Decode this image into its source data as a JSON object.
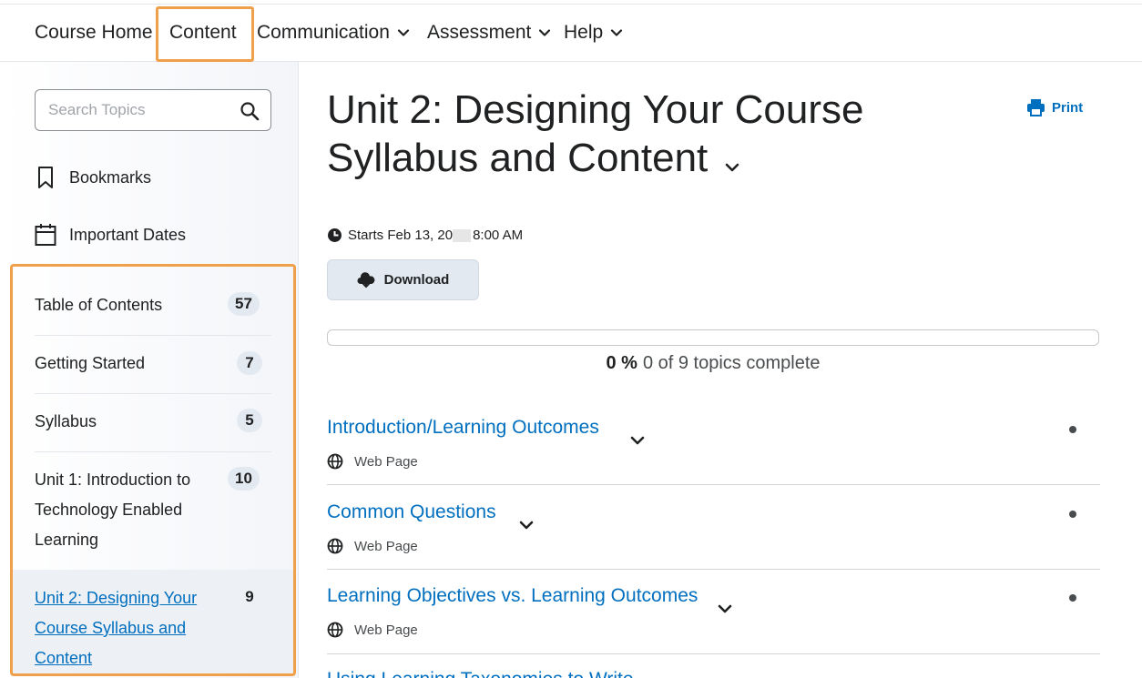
{
  "nav": {
    "items": [
      {
        "label": "Course Home",
        "dropdown": false
      },
      {
        "label": "Content",
        "dropdown": false
      },
      {
        "label": "Communication",
        "dropdown": true
      },
      {
        "label": "Assessment",
        "dropdown": true
      },
      {
        "label": "Help",
        "dropdown": true
      }
    ]
  },
  "sidebar": {
    "search_placeholder": "Search Topics",
    "bookmarks_label": "Bookmarks",
    "important_dates_label": "Important Dates",
    "toc": [
      {
        "label": "Table of Contents",
        "count": "57"
      },
      {
        "label": "Getting Started",
        "count": "7"
      },
      {
        "label": "Syllabus",
        "count": "5"
      },
      {
        "label": "Unit 1: Introduction to Technology Enabled Learning",
        "count": "10"
      },
      {
        "label": "Unit 2: Designing Your Course Syllabus and Content",
        "count": "9"
      }
    ]
  },
  "main": {
    "title": "Unit 2: Designing Your Course Syllabus and Content",
    "print_label": "Print",
    "starts_prefix": "Starts Feb 13, 20",
    "starts_suffix": "8:00 AM",
    "download_label": "Download",
    "progress": {
      "percent_label": "0 %",
      "complete_label": "0 of 9 topics complete",
      "fraction": 0
    },
    "topics": [
      {
        "title": "Introduction/Learning Outcomes",
        "type": "Web Page"
      },
      {
        "title": "Common Questions",
        "type": "Web Page"
      },
      {
        "title": "Learning Objectives vs. Learning Outcomes",
        "type": "Web Page"
      },
      {
        "title": "Using Learning Taxonomies to Write",
        "type": ""
      }
    ]
  },
  "colors": {
    "accent": "#006fbf",
    "highlight": "#f0a04b",
    "badge_bg": "#e3e9f1"
  }
}
